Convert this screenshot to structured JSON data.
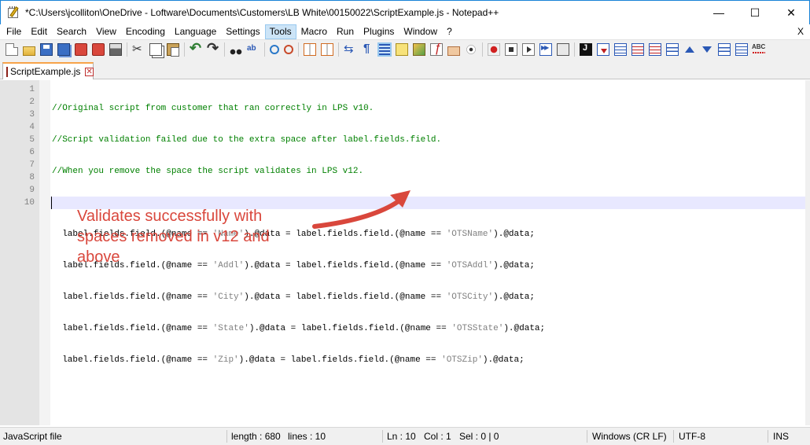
{
  "window": {
    "title": "*C:\\Users\\jcolliton\\OneDrive - Loftware\\Documents\\Customers\\LB White\\00150022\\ScriptExample.js - Notepad++",
    "minimize_glyph": "—",
    "maximize_glyph": "☐",
    "close_glyph": "✕"
  },
  "menu": {
    "items": [
      "File",
      "Edit",
      "Search",
      "View",
      "Encoding",
      "Language",
      "Settings",
      "Tools",
      "Macro",
      "Run",
      "Plugins",
      "Window",
      "?"
    ],
    "active": "Tools",
    "close_label": "X"
  },
  "tab": {
    "label": "ScriptExample.js",
    "close_glyph": "✕"
  },
  "editor": {
    "line_numbers": [
      "1",
      "2",
      "3",
      "4",
      "5",
      "6",
      "7",
      "8",
      "9",
      "10"
    ],
    "lines": [
      "//Original script from customer that ran correctly in LPS v10.",
      "//Script validation failed due to the extra space after label.fields.field.",
      "//When you remove the space the script validates in LPS v12.",
      "",
      "  label.fields.field.(@name == 'Name').@data = label.fields.field.(@name == 'OTSName').@data;",
      "  label.fields.field.(@name == 'Addl').@data = label.fields.field.(@name == 'OTSAddl').@data;",
      "  label.fields.field.(@name == 'City').@data = label.fields.field.(@name == 'OTSCity').@data;",
      "  label.fields.field.(@name == 'State').@data = label.fields.field.(@name == 'OTSState').@data;",
      "  label.fields.field.(@name == 'Zip').@data = label.fields.field.(@name == 'OTSZip').@data;",
      ""
    ],
    "comment_color": "#008000",
    "current_line": "10"
  },
  "annotation": {
    "text_line1": "Validates successfully with",
    "text_line2": "spaces removed in v12 and",
    "text_line3": "above",
    "color": "#d9473c"
  },
  "statusbar": {
    "file_type": "JavaScript file",
    "length": "length : 680",
    "lines": "lines : 10",
    "ln": "Ln : 10",
    "col": "Col : 1",
    "sel": "Sel : 0 | 0",
    "eol": "Windows (CR LF)",
    "encoding": "UTF-8",
    "mode": "INS"
  },
  "toolbar": {
    "icons": [
      "new-file-icon",
      "open-file-icon",
      "save-icon",
      "save-all-icon",
      "close-icon",
      "close-all-icon",
      "print-icon",
      "cut-icon",
      "copy-icon",
      "paste-icon",
      "undo-icon",
      "redo-icon",
      "find-icon",
      "replace-icon",
      "zoom-in-icon",
      "zoom-out-icon",
      "sync-vertical-icon",
      "sync-horizontal-icon",
      "word-wrap-icon",
      "show-all-chars-icon",
      "indent-guide-icon",
      "user-language-icon",
      "document-map-icon",
      "function-list-icon",
      "folder-as-workspace-icon",
      "monitoring-icon",
      "record-macro-icon",
      "stop-macro-icon",
      "play-macro-icon",
      "run-macro-multiple-icon",
      "save-macro-icon",
      "jstool-icon",
      "plugin-icon-1",
      "plugin-icon-2",
      "plugin-icon-3",
      "plugin-icon-4",
      "move-up-icon",
      "move-down-icon",
      "sum-icon",
      "plugin-icon-5",
      "spell-check-icon"
    ]
  }
}
